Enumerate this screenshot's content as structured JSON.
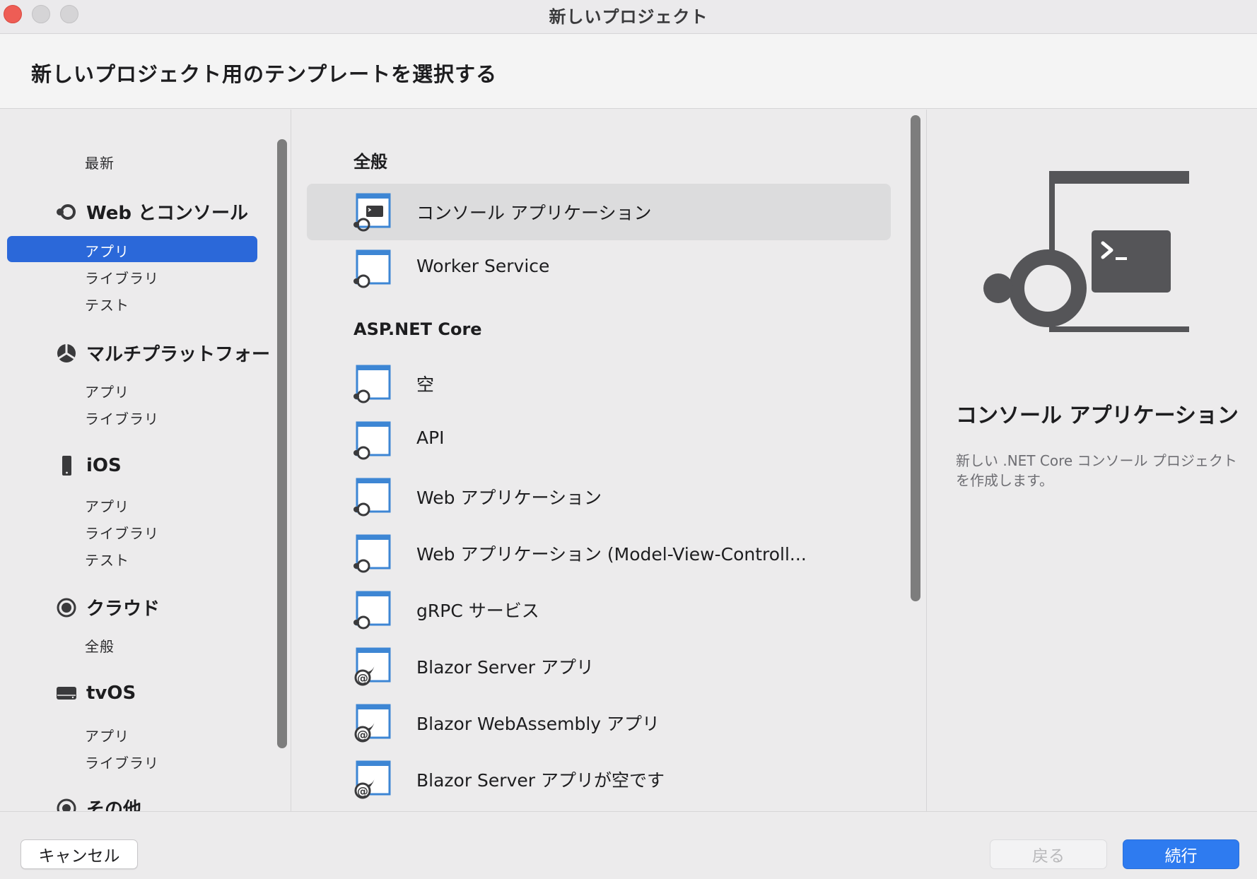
{
  "window": {
    "title": "新しいプロジェクト"
  },
  "header": {
    "title": "新しいプロジェクト用のテンプレートを選択する"
  },
  "sidebar": {
    "recent_label": "最新",
    "categories": [
      {
        "label": "Web とコンソール",
        "icon": "dotnet-icon",
        "items": [
          "アプリ",
          "ライブラリ",
          "テスト"
        ]
      },
      {
        "label": "マルチプラットフォー",
        "icon": "multiplatform-icon",
        "items": [
          "アプリ",
          "ライブラリ"
        ]
      },
      {
        "label": "iOS",
        "icon": "phone-icon",
        "items": [
          "アプリ",
          "ライブラリ",
          "テスト"
        ]
      },
      {
        "label": "クラウド",
        "icon": "cloud-icon",
        "items": [
          "全般"
        ]
      },
      {
        "label": "tvOS",
        "icon": "tv-icon",
        "items": [
          "アプリ",
          "ライブラリ"
        ]
      },
      {
        "label": "その他",
        "icon": "other-icon",
        "items": []
      }
    ],
    "selected": "Web とコンソール / アプリ"
  },
  "templates": {
    "sections": [
      {
        "title": "全般",
        "items": [
          "コンソール アプリケーション",
          "Worker Service"
        ]
      },
      {
        "title": "ASP.NET Core",
        "items": [
          "空",
          "API",
          "Web アプリケーション",
          "Web アプリケーション (Model-View-Controll...",
          "gRPC サービス",
          "Blazor Server アプリ",
          "Blazor WebAssembly アプリ",
          "Blazor Server アプリが空です"
        ]
      }
    ],
    "selected": "コンソール アプリケーション"
  },
  "detail": {
    "title": "コンソール アプリケーション",
    "description": "新しい .NET Core コンソール プロジェクトを作成します。"
  },
  "footer": {
    "cancel_label": "キャンセル",
    "back_label": "戻る",
    "next_label": "続行"
  },
  "colors": {
    "accent": "#2b68d9",
    "primary_button": "#2e7bf0",
    "close_button": "#ee5d55"
  }
}
